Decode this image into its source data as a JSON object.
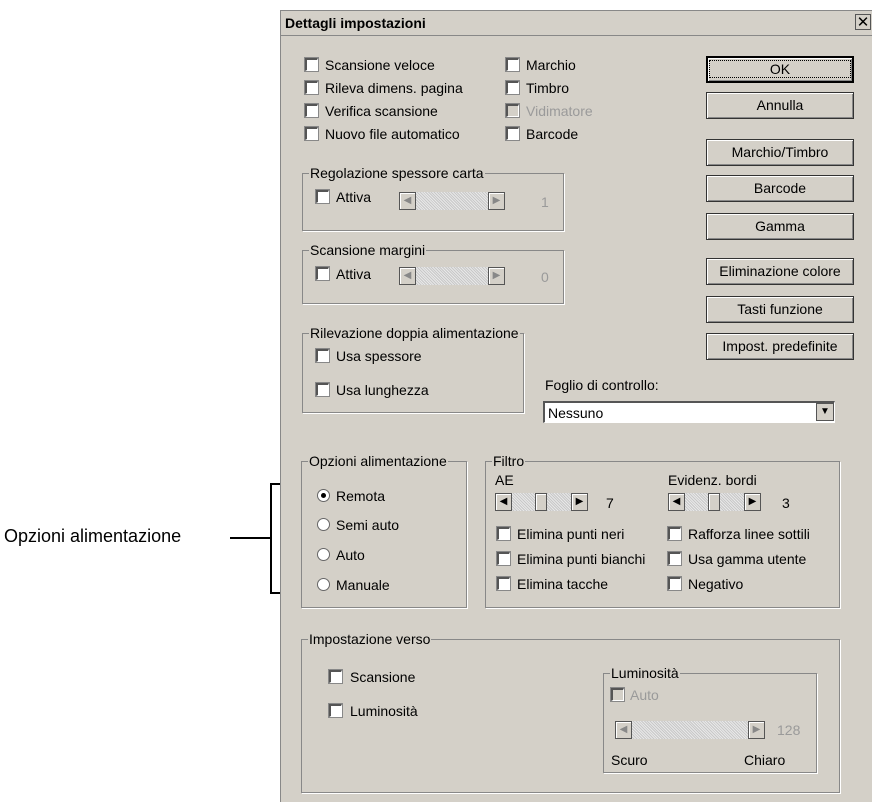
{
  "callout": {
    "label": "Opzioni alimentazione"
  },
  "dialog": {
    "title": "Dettagli impostazioni",
    "close_glyph": "✕",
    "checks_left": [
      {
        "label": "Scansione veloce"
      },
      {
        "label": "Rileva dimens. pagina"
      },
      {
        "label": "Verifica scansione"
      },
      {
        "label": "Nuovo file automatico"
      }
    ],
    "checks_mid": [
      {
        "label": "Marchio",
        "enabled": true
      },
      {
        "label": "Timbro",
        "enabled": true
      },
      {
        "label": "Vidimatore",
        "enabled": false
      },
      {
        "label": "Barcode",
        "enabled": true
      }
    ],
    "buttons": [
      {
        "label": "OK"
      },
      {
        "label": "Annulla"
      },
      {
        "label": "Marchio/Timbro"
      },
      {
        "label": "Barcode"
      },
      {
        "label": "Gamma"
      },
      {
        "label": "Eliminazione colore"
      },
      {
        "label": "Tasti funzione"
      },
      {
        "label": "Impost. predefinite"
      }
    ],
    "paper_thickness": {
      "legend": "Regolazione spessore carta",
      "active_label": "Attiva",
      "value": "1"
    },
    "margin_scan": {
      "legend": "Scansione margini",
      "active_label": "Attiva",
      "value": "0"
    },
    "double_feed": {
      "legend": "Rilevazione doppia alimentazione",
      "options": [
        "Usa spessore",
        "Usa lunghezza"
      ]
    },
    "control_sheet": {
      "label": "Foglio di controllo:",
      "selected": "Nessuno"
    },
    "feed_options": {
      "legend": "Opzioni alimentazione",
      "options": [
        "Remota",
        "Semi auto",
        "Auto",
        "Manuale"
      ],
      "selected": "Remota"
    },
    "filter": {
      "legend": "Filtro",
      "ae_label": "AE",
      "ae_value": "7",
      "edge_label": "Evidenz. bordi",
      "edge_value": "3",
      "left_checks": [
        "Elimina punti neri",
        "Elimina punti bianchi",
        "Elimina tacche"
      ],
      "right_checks": [
        "Rafforza linee sottili",
        "Usa gamma utente",
        "Negativo"
      ]
    },
    "back_side": {
      "legend": "Impostazione verso",
      "checks": [
        "Scansione",
        "Luminosità"
      ],
      "brightness": {
        "legend": "Luminosità",
        "auto_label": "Auto",
        "value": "128",
        "dark": "Scuro",
        "light": "Chiaro"
      }
    }
  }
}
